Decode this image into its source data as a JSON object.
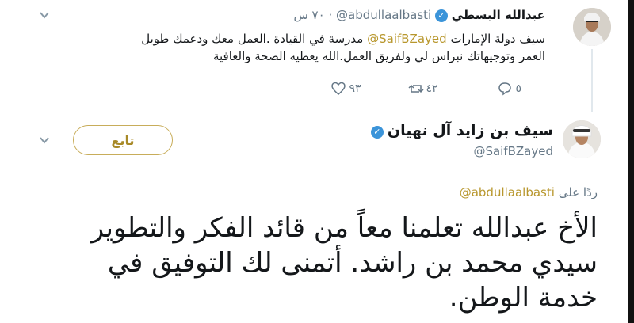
{
  "reply_tweet": {
    "author_name": "عبدالله البسطي",
    "handle": "@abdullaalbasti",
    "time": "٧٠ س",
    "text_prefix": "سيف دولة الإمارات",
    "mention": "@SaifBZayed",
    "text_line1_suffix": "مدرسة في القيادة .العمل معك ودعمك طويل",
    "text_line2": "العمر وتوجيهاتك نبراس لي ولفريق العمل.الله يعطيه الصحة والعافية",
    "replies": "٥",
    "retweets": "٤٢",
    "likes": "٩٣"
  },
  "main_tweet": {
    "author_name": "سيف بن زايد آل نهيان",
    "handle": "@SaifBZayed",
    "follow_label": "تابع",
    "reply_to_label": "ردًا على",
    "reply_to_handle": "@abdullaalbasti",
    "text_lines": [
      "الأخ عبدالله تعلمنا معاً من قائد الفكر والتطوير",
      "سيدي محمد بن راشد. أتمنى لك التوفيق في",
      "خدمة الوطن."
    ]
  },
  "colors": {
    "accent": "#b8972d",
    "verified": "#3b94d9",
    "muted": "#657786",
    "thread": "#c8ad5a"
  },
  "icons": [
    "chevron-down-icon",
    "verified-icon",
    "reply-icon",
    "retweet-icon",
    "like-icon"
  ]
}
